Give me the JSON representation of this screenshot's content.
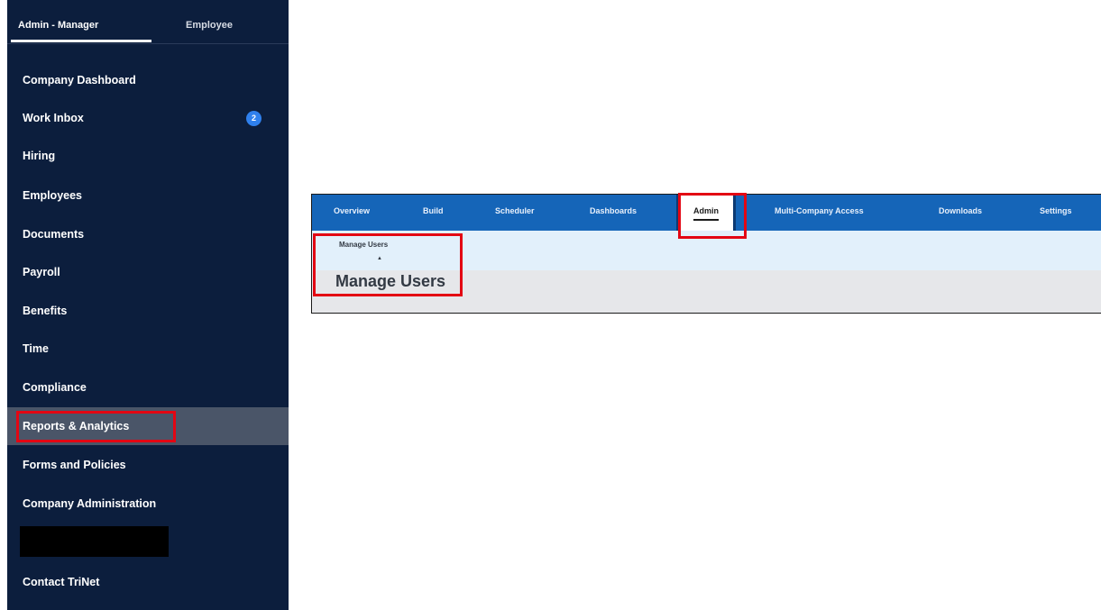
{
  "sidebar": {
    "role_tabs": {
      "admin_manager": "Admin - Manager",
      "employee": "Employee"
    },
    "items": [
      {
        "label": "Company Dashboard"
      },
      {
        "label": "Work Inbox",
        "badge": "2"
      },
      {
        "label": "Hiring"
      },
      {
        "label": "Employees"
      },
      {
        "label": "Documents"
      },
      {
        "label": "Payroll"
      },
      {
        "label": "Benefits"
      },
      {
        "label": "Time"
      },
      {
        "label": "Compliance"
      },
      {
        "label": "Reports & Analytics",
        "active": true
      },
      {
        "label": "Forms and Policies"
      },
      {
        "label": "Company Administration"
      },
      {
        "label": "Contact TriNet"
      }
    ]
  },
  "admin_panel": {
    "top_nav": [
      {
        "label": "Overview"
      },
      {
        "label": "Build"
      },
      {
        "label": "Scheduler"
      },
      {
        "label": "Dashboards"
      },
      {
        "label": "Admin",
        "active": true
      },
      {
        "label": "Multi-Company Access"
      },
      {
        "label": "Downloads"
      },
      {
        "label": "Settings"
      }
    ],
    "sub_nav": {
      "label": "Manage Users"
    },
    "page_title": "Manage Users"
  },
  "colors": {
    "sidebar_bg": "#0c1e3d",
    "sidebar_active": "#4a5568",
    "badge": "#2f80ed",
    "top_nav_bg": "#1565b8",
    "sub_nav_bg": "#e2f0fb",
    "highlight": "#e30613"
  }
}
